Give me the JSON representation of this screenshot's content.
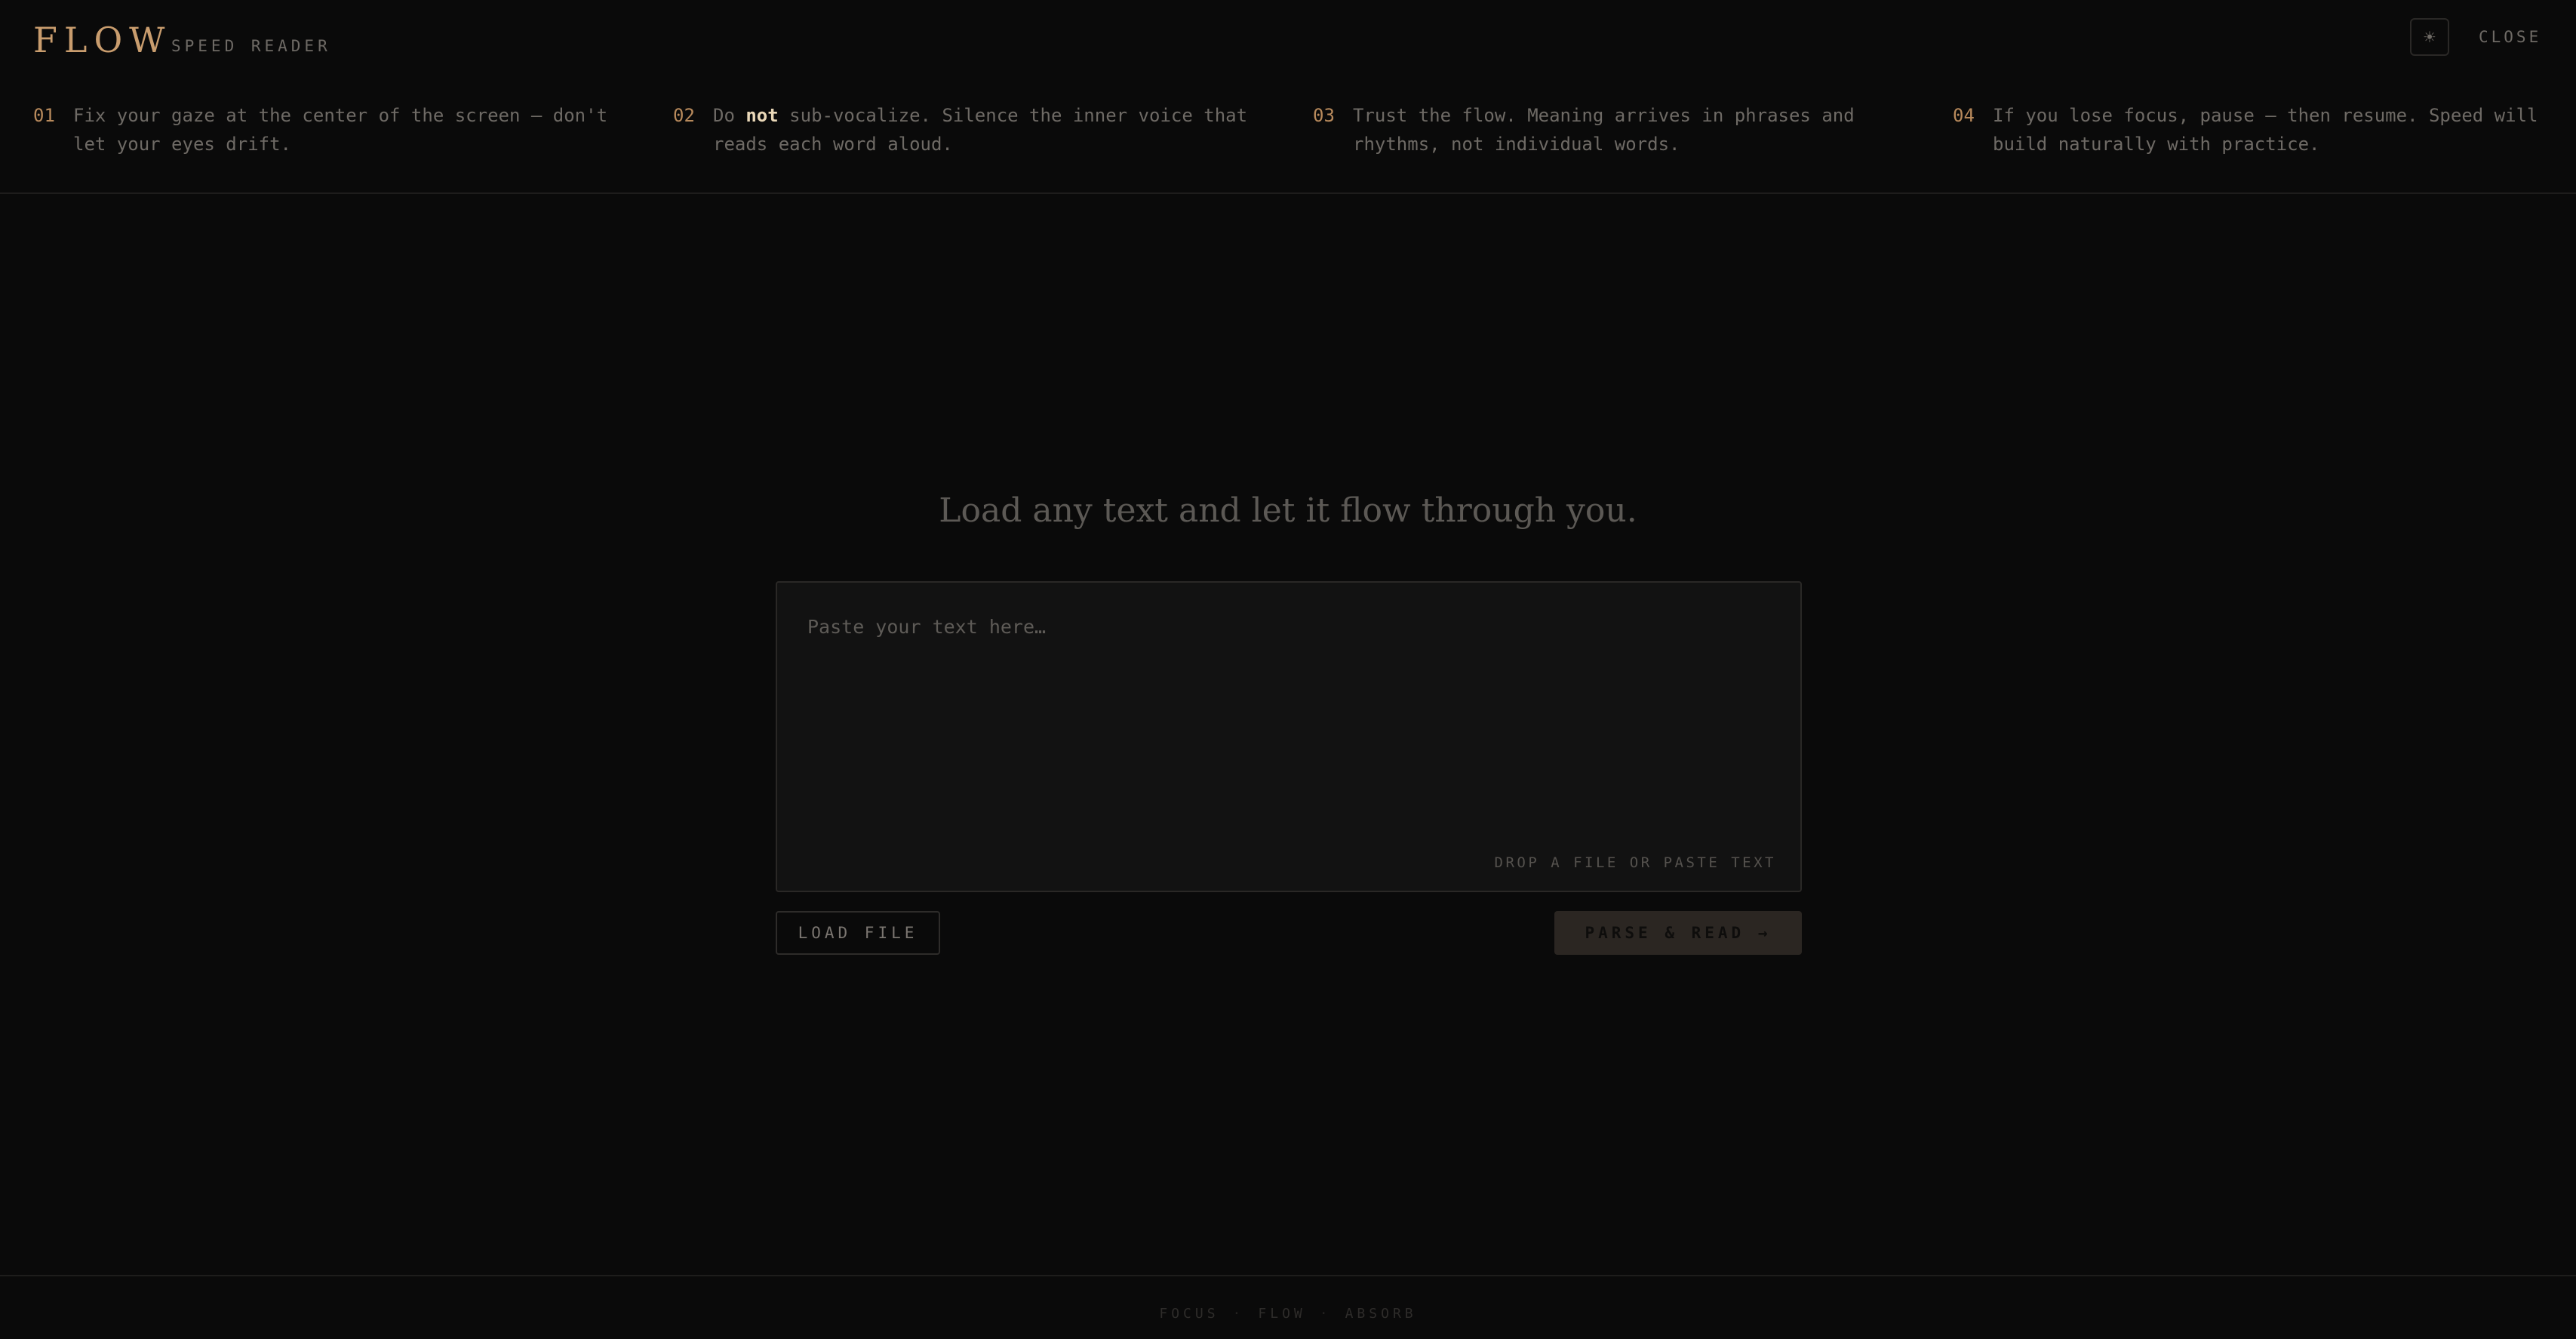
{
  "header": {
    "logo": "FLOW",
    "subtitle": "SPEED READER",
    "theme_toggle_icon": "sun-icon",
    "theme_toggle_glyph": "☀",
    "close_label": "CLOSE"
  },
  "tips": [
    {
      "num": "01",
      "text": "Fix your gaze at the center of the screen — don't let your eyes drift."
    },
    {
      "num": "02",
      "text_before": "Do ",
      "emphasis": "not",
      "text_after": " sub-vocalize. Silence the inner voice that reads each word aloud."
    },
    {
      "num": "03",
      "text": "Trust the flow. Meaning arrives in phrases and rhythms, not individual words."
    },
    {
      "num": "04",
      "text": "If you lose focus, pause — then resume. Speed will build naturally with practice."
    }
  ],
  "main": {
    "tagline": "Load any text and let it flow through you.",
    "editor": {
      "placeholder": "Paste your text here…",
      "value": "",
      "drop_hint": "DROP A FILE OR PASTE TEXT"
    },
    "load_button": "LOAD FILE",
    "parse_button": "PARSE & READ →"
  },
  "footer": {
    "words": [
      "FOCUS",
      "FLOW",
      "ABSORB"
    ],
    "separator": "·"
  },
  "colors": {
    "background": "#0a0a0a",
    "accent": "#c99d6e",
    "emphasis": "#ead8b8",
    "muted_text": "#6e6a65"
  }
}
